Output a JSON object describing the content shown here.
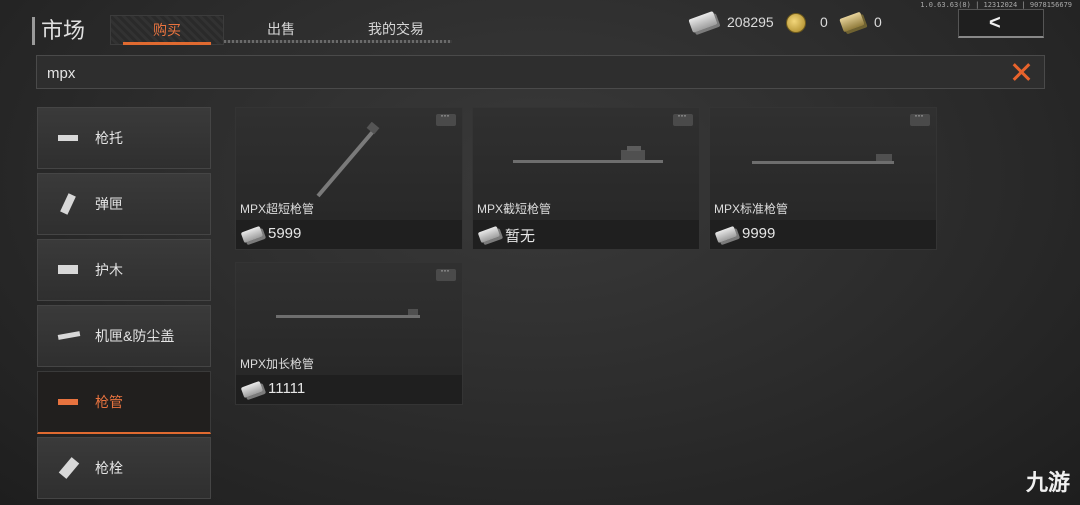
{
  "header": {
    "title": "市场",
    "tabs": [
      {
        "label": "购买",
        "active": true
      },
      {
        "label": "出售",
        "active": false
      },
      {
        "label": "我的交易",
        "active": false
      }
    ],
    "currencies": [
      {
        "icon": "cash-icon",
        "value": "208295"
      },
      {
        "icon": "coin-icon",
        "value": "0"
      },
      {
        "icon": "bond-icon",
        "value": "0"
      }
    ],
    "back_icon": "back-arrow-icon",
    "version": "1.0.63.63(8) | 12312024 | 9078156679"
  },
  "search": {
    "value": "mpx",
    "clear_icon": "close-icon"
  },
  "sidebar": {
    "items": [
      {
        "label": "枪托",
        "icon": "stock-icon",
        "active": false
      },
      {
        "label": "弹匣",
        "icon": "magazine-icon",
        "active": false
      },
      {
        "label": "护木",
        "icon": "handguard-icon",
        "active": false
      },
      {
        "label": "机匣&防尘盖",
        "icon": "receiver-icon",
        "active": false
      },
      {
        "label": "枪管",
        "icon": "barrel-icon",
        "active": true
      },
      {
        "label": "枪栓",
        "icon": "bolt-icon",
        "active": false
      }
    ]
  },
  "items": [
    {
      "name": "MPX超短枪管",
      "price": "5999"
    },
    {
      "name": "MPX截短枪管",
      "price": "暂无"
    },
    {
      "name": "MPX标准枪管",
      "price": "9999"
    },
    {
      "name": "MPX加长枪管",
      "price": "11111"
    }
  ],
  "watermark": "九游",
  "colors": {
    "accent": "#e06a30",
    "background": "#2b2b2b"
  }
}
